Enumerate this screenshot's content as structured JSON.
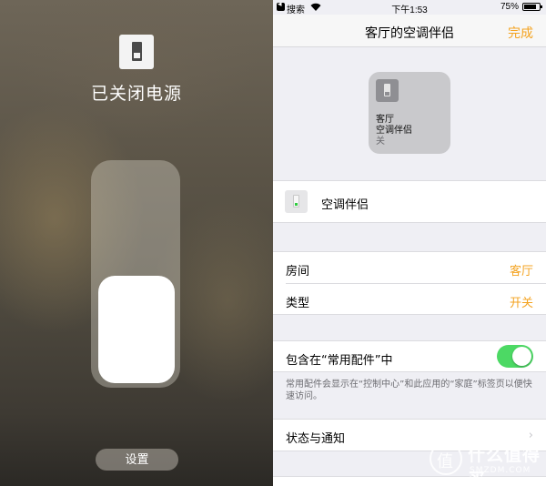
{
  "left_panel": {
    "title": "已关闭电源",
    "toggle_state": "off",
    "settings_label": "设置"
  },
  "statusbar": {
    "back_label": "搜索",
    "time": "下午1:53",
    "battery": "75%"
  },
  "navbar": {
    "title": "客厅的空调伴侣",
    "done_label": "完成"
  },
  "tile": {
    "line1": "客厅",
    "line2": "空调伴侣",
    "state": "关"
  },
  "accessory": {
    "name": "空调伴侣"
  },
  "settings": {
    "room_label": "房间",
    "room_value": "客厅",
    "type_label": "类型",
    "type_value": "开关"
  },
  "favorites": {
    "label": "包含在“常用配件”中",
    "enabled": true,
    "note": "常用配件会显示在“控制中心”和此应用的“家庭”标签页以便快速访问。"
  },
  "status_notifications": {
    "label": "状态与通知"
  },
  "watermark": {
    "text": "什么值得买",
    "sub": "SMZDM.COM"
  },
  "colors": {
    "accent": "#f4a320",
    "switch_on": "#4cd964",
    "grouped_bg": "#efeff4"
  }
}
